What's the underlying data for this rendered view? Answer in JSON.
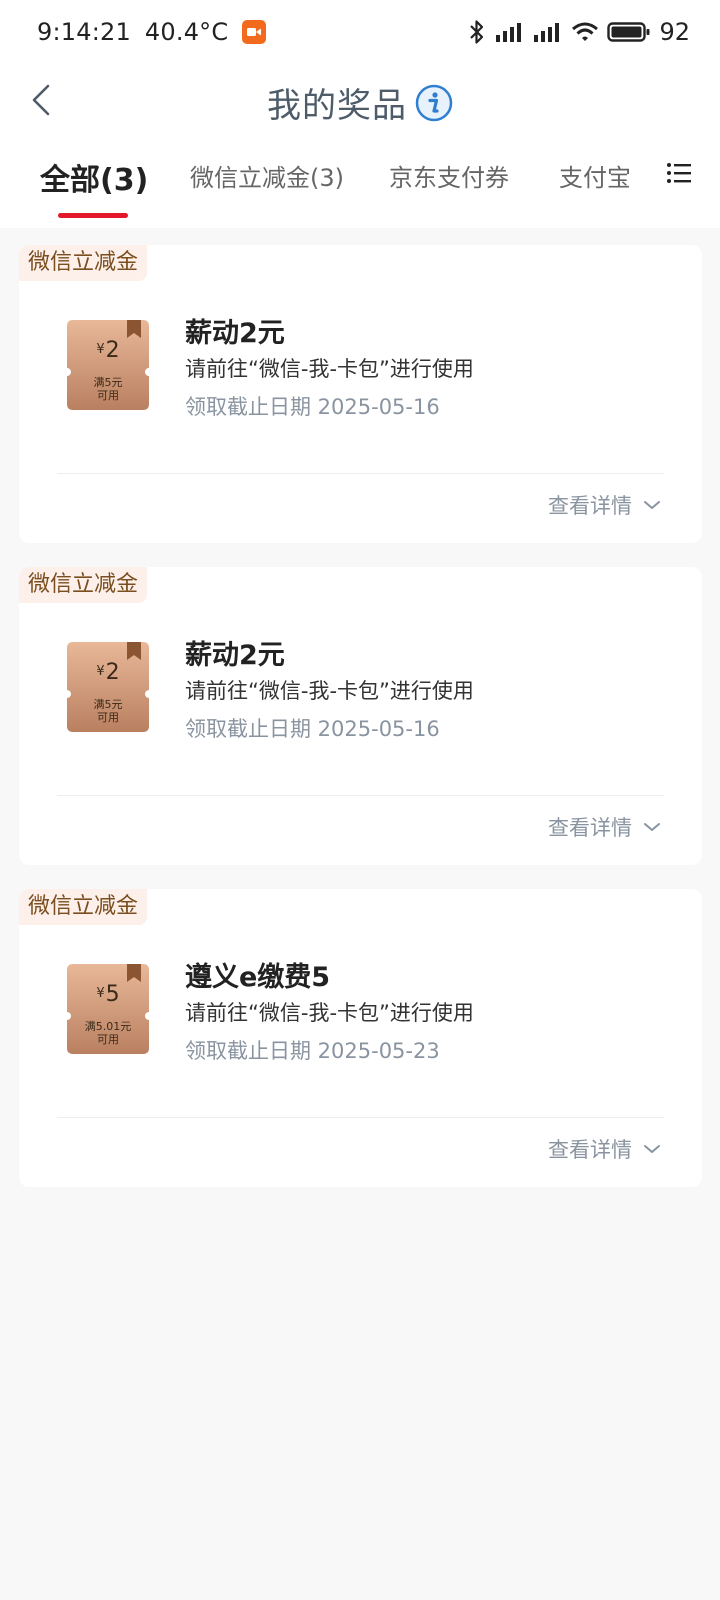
{
  "status_bar": {
    "time": "9:14:21",
    "temperature": "40.4°C",
    "battery": "92",
    "icons": [
      "recording-icon",
      "bluetooth-icon",
      "signal-icon",
      "signal-icon",
      "wifi-icon",
      "battery-icon"
    ]
  },
  "header": {
    "title": "我的奖品",
    "back_icon": "back-arrow-icon",
    "info_icon": "info-icon"
  },
  "tabs": [
    {
      "label": "全部(3)",
      "active": true
    },
    {
      "label": "微信立减金(3)",
      "active": false
    },
    {
      "label": "京东支付券",
      "active": false
    },
    {
      "label": "支付宝",
      "active": false
    }
  ],
  "menu_icon": "list-menu-icon",
  "colors": {
    "accent": "#e5172b",
    "tag_bg": "#fdf0ea",
    "tag_text": "#7a4e1f",
    "coupon": "#c48e6a"
  },
  "cards": [
    {
      "tag": "微信立减金",
      "coupon_currency": "¥",
      "coupon_value": "2",
      "coupon_condition": "满5元",
      "coupon_usable": "可用",
      "coupon_badge": "券",
      "title": "薪动2元",
      "description": "请前往“微信-我-卡包”进行使用",
      "deadline": "领取截止日期 2025-05-16",
      "detail_label": "查看详情"
    },
    {
      "tag": "微信立减金",
      "coupon_currency": "¥",
      "coupon_value": "2",
      "coupon_condition": "满5元",
      "coupon_usable": "可用",
      "coupon_badge": "券",
      "title": "薪动2元",
      "description": "请前往“微信-我-卡包”进行使用",
      "deadline": "领取截止日期 2025-05-16",
      "detail_label": "查看详情"
    },
    {
      "tag": "微信立减金",
      "coupon_currency": "¥",
      "coupon_value": "5",
      "coupon_condition": "满5.01元",
      "coupon_usable": "可用",
      "coupon_badge": "券",
      "title": "遵义e缴费5",
      "description": "请前往“微信-我-卡包”进行使用",
      "deadline": "领取截止日期 2025-05-23",
      "detail_label": "查看详情"
    }
  ]
}
